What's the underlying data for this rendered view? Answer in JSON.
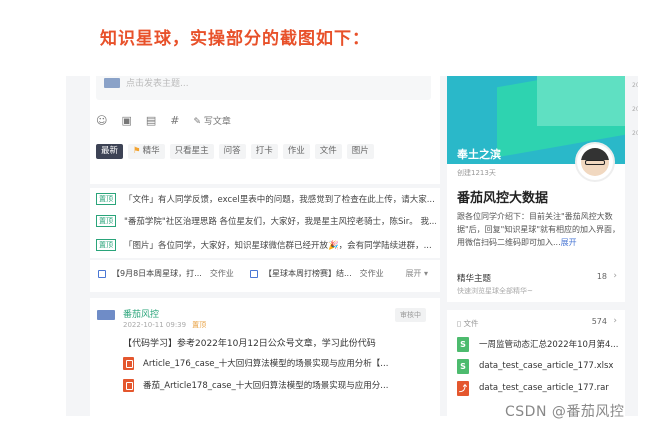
{
  "headline": "知识星球，实操部分的截图如下：",
  "composer": {
    "placeholder": "点击发表主题...",
    "tools": [
      "☺",
      "▣",
      "▤",
      "#"
    ],
    "write_label": "写文章"
  },
  "tabs": [
    {
      "label": "最新",
      "active": true
    },
    {
      "label": "精华",
      "badge": "⚑"
    },
    {
      "label": "只看星主"
    },
    {
      "label": "问答"
    },
    {
      "label": "打卡"
    },
    {
      "label": "作业"
    },
    {
      "label": "文件"
    },
    {
      "label": "图片"
    }
  ],
  "feed": [
    {
      "tag": "置顶",
      "text": "「文件」有人同学反馈，excel里表中的问题，我感觉到了检查在此上传，请大家..."
    },
    {
      "tag": "置顶",
      "text": "\"番茄学院\"社区治理思路 各位星友们，大家好，我是星主风控老骑士，陈Sir。 我..."
    },
    {
      "tag": "置顶",
      "text": "「图片」各位同学，大家好，知识星球微信群已经开放🎉，会有同学陆续进群，..."
    }
  ],
  "pins": {
    "items": [
      {
        "text": "【9月8日本周星球，打...",
        "type": "交作业"
      },
      {
        "text": "【星球本周打榜赛】结...",
        "type": "交作业"
      }
    ],
    "more": "展开 ▾"
  },
  "post": {
    "author": "番茄风控",
    "date": "2022-10-11 09:39",
    "topic": "置顶",
    "status": "审核中",
    "text": "【代码学习】参考2022年10月12日公众号文章，学习此份代码",
    "attachments": [
      "Article_176_case_十大回归算法模型的场景实现与应用分析【...",
      "番茄_Article178_case_十大回归算法模型的场景实现与应用分..."
    ]
  },
  "profile": {
    "banner_name": "奉土之滨",
    "created": "创建1213天",
    "group_name": "番茄风控大数据",
    "desc": "跟各位同学介绍下：目前关注\"番茄风控大数据\"后，回复\"知识星球\"就有相应的加入界面，用微信扫码二维码即可加入...",
    "expand": "展开"
  },
  "essence": {
    "title": "精华主题",
    "subtitle": "快速浏览星球全部精华~",
    "count": "18"
  },
  "files": {
    "title": "文件",
    "count": "574",
    "items": [
      {
        "name": "一周监管动态汇总2022年10月第4...",
        "icon": "S",
        "color": "green"
      },
      {
        "name": "data_test_case_article_177.xlsx",
        "icon": "S",
        "color": "green"
      },
      {
        "name": "data_test_case_article_177.rar",
        "icon": "⤴",
        "color": "red"
      }
    ]
  },
  "rail": [
    "20",
    "20",
    "20"
  ],
  "watermark": "CSDN @番茄风控",
  "icons": {
    "chevron": "›",
    "file_small": "▯"
  }
}
